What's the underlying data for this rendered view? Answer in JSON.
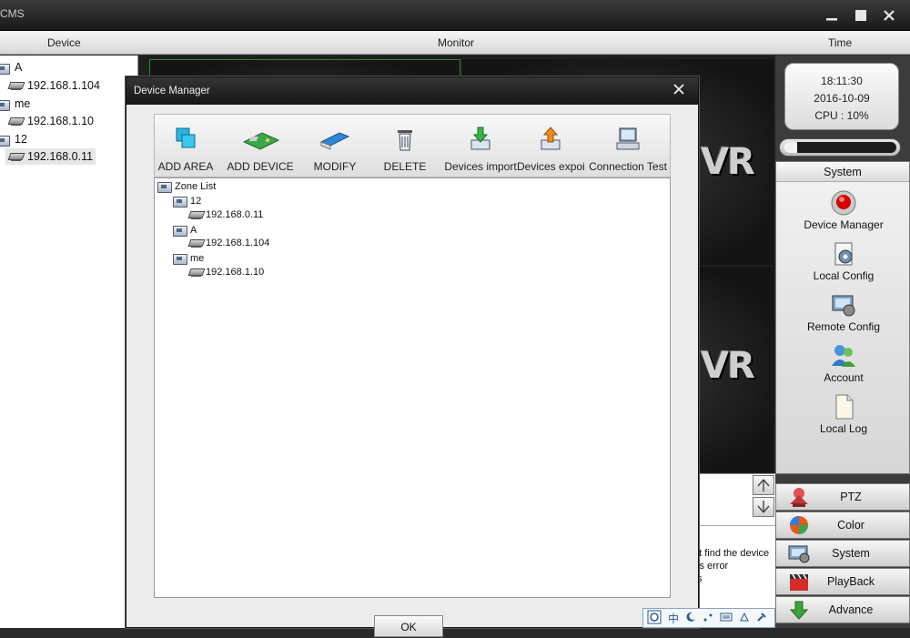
{
  "app": {
    "title": "CMS"
  },
  "columns": {
    "device": "Device",
    "monitor": "Monitor",
    "time": "Time"
  },
  "tree": [
    {
      "label": "A",
      "type": "area"
    },
    {
      "label": "192.168.1.104",
      "type": "device"
    },
    {
      "label": "me",
      "type": "area"
    },
    {
      "label": "192.168.1.10",
      "type": "device"
    },
    {
      "label": "12",
      "type": "area"
    },
    {
      "label": "192.168.0.11",
      "type": "device",
      "selected": true
    }
  ],
  "monitor": {
    "watermark": "VR"
  },
  "clock": {
    "time": "18:11:30",
    "date": "2016-10-09",
    "cpu": "CPU : 10%"
  },
  "progress": {
    "fraction": 0.12
  },
  "system_panel": {
    "header": "System",
    "items": [
      {
        "label": "Device Manager",
        "icon": "red-record-icon"
      },
      {
        "label": "Local Config",
        "icon": "local-config-icon"
      },
      {
        "label": "Remote Config",
        "icon": "remote-config-icon"
      },
      {
        "label": "Account",
        "icon": "users-icon"
      },
      {
        "label": "Local Log",
        "icon": "document-icon"
      }
    ]
  },
  "nav": [
    {
      "label": "PTZ",
      "icon": "ptz-icon"
    },
    {
      "label": "Color",
      "icon": "color-icon"
    },
    {
      "label": "System",
      "icon": "system-icon"
    },
    {
      "label": "PlayBack",
      "icon": "clapper-icon"
    },
    {
      "label": "Advance",
      "icon": "advance-icon"
    }
  ],
  "log_lines": [
    "'t find the device",
    "is error",
    "s"
  ],
  "dialog": {
    "title": "Device Manager",
    "toolbar": [
      {
        "label": "ADD AREA",
        "icon": "add-area-icon"
      },
      {
        "label": "ADD DEVICE",
        "icon": "add-device-icon"
      },
      {
        "label": "MODIFY",
        "icon": "modify-icon"
      },
      {
        "label": "DELETE",
        "icon": "trash-icon"
      },
      {
        "label": "Devices import",
        "icon": "import-icon"
      },
      {
        "label": "Devices expoi",
        "icon": "export-icon"
      },
      {
        "label": "Connection  Test",
        "icon": "connection-test-icon"
      }
    ],
    "zone_list": {
      "root": "Zone List",
      "children": [
        {
          "label": "12",
          "devices": [
            "192.168.0.11"
          ]
        },
        {
          "label": "A",
          "devices": [
            "192.168.1.104"
          ]
        },
        {
          "label": "me",
          "devices": [
            "192.168.1.10"
          ]
        }
      ]
    },
    "ok": "OK"
  },
  "ime": {
    "lang": "中"
  },
  "colors": {
    "accent_red": "#d40000",
    "bg_dark": "#2a2a2a"
  }
}
